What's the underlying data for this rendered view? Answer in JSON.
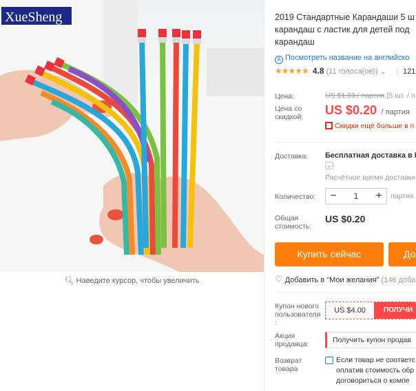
{
  "brand": "XueSheng",
  "zoom_hint": "Наведите курсор, чтобы увеличить",
  "product": {
    "title_line1": "2019 Стандартные Карандаши 5 ш",
    "title_line2": "карандаш с ластик для детей под",
    "title_line3": "карандаш",
    "translate_link": "Посмотреть название на английско",
    "rating_stars": "★★★★★",
    "rating_score": "4.8",
    "rating_count": "(11 голоса(ов))",
    "orders": "121"
  },
  "price": {
    "label": "Цена:",
    "old": "US $1.69 / партия",
    "old_extra": "(5 шт. / п",
    "discount_label_1": "Цена со",
    "discount_label_2": "скидкой:",
    "new": "US $0.20",
    "new_unit": "/ партия",
    "promo": "Скидки ещё больше в п"
  },
  "shipping": {
    "label": "Доставка:",
    "value": "Бесплатная доставка в R",
    "time": "Расчётное время доставки"
  },
  "quantity": {
    "label": "Количество:",
    "minus": "−",
    "value": "1",
    "plus": "+",
    "unit": "партия"
  },
  "total": {
    "label_1": "Общая",
    "label_2": "стоимость:",
    "value": "US $0.20"
  },
  "actions": {
    "buy": "Купить сейчас",
    "cart": "До"
  },
  "wishlist": {
    "label": "Добавить в \"Мои желания\"",
    "count": "(146 добав"
  },
  "coupon": {
    "label_1": "Купон нового",
    "label_2": "пользователя",
    "label_3": ":",
    "amount": "US $4.00",
    "get": "ПОЛУЧИ"
  },
  "seller_promo": {
    "label_1": "Акция",
    "label_2": "продавца:",
    "text": "Получить купон продав"
  },
  "returns": {
    "label_1": "Возврат",
    "label_2": "товара",
    "line1": "Если товар не соответс",
    "line2": "оплатив стоимость обр",
    "line3": "договориться о компе"
  },
  "colors": {
    "accent": "#ff4747",
    "buy": "#ff7d0b",
    "link": "#1a73e8",
    "brand_bg": "#1c2a86"
  }
}
